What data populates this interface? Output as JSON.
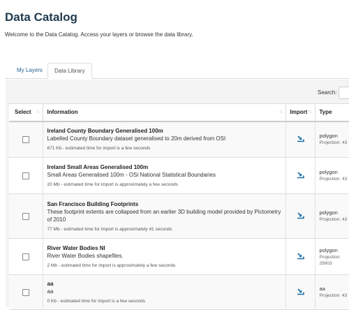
{
  "page": {
    "title": "Data Catalog",
    "welcome": "Welcome to the Data Catalog. Access your layers or browse the data library."
  },
  "tabs": [
    {
      "label": "My Layers",
      "active": false
    },
    {
      "label": "Data Library",
      "active": true
    }
  ],
  "search": {
    "label": "Search:",
    "value": ""
  },
  "table": {
    "columns": {
      "select": "Select",
      "information": "Information",
      "import": "Import",
      "type": "Type"
    },
    "rows": [
      {
        "title": "Ireland County Boundary Generalised 100m",
        "description": "Labelled County Boundary dataset generalised to 20m derived from OSI",
        "meta": "671 Kb - estimated time for import is a few seconds",
        "type": "polygon",
        "projection": "Projection: 43"
      },
      {
        "title": "Ireland Small Areas Generalised 100m",
        "description": "Small Areas Generalised 100m - OSi National Statistical Boundaries",
        "meta": "20 Mb - estimated time for import is approximately a few seconds",
        "type": "polygon",
        "projection": "Projection: 43"
      },
      {
        "title": "San Francisco Building Footprints",
        "description": "These footprint extents are collapsed from an earlier 3D building model provided by Pictometry of 2010",
        "meta": "77 Mb - estimated time for import is approximately 41 seconds",
        "type": "polygon",
        "projection": "Projection: 43"
      },
      {
        "title": "River Water Bodies NI",
        "description": "River Water Bodies shapefiles.",
        "meta": "2 Mb - estimated time for import is approximately a few seconds",
        "type": "polygon",
        "projection": "Projection:",
        "projection_extra": "29903"
      },
      {
        "title": "aa",
        "description": "aa",
        "meta": "0 Kb - estimated time for import is a few seconds",
        "type": "aa",
        "projection": "Projection: 43"
      }
    ]
  },
  "icons": {
    "import": "import-icon",
    "sort": "sort-icon"
  },
  "colors": {
    "title": "#1f3a4d",
    "link": "#2a6496",
    "import_icon": "#1e6fa8"
  }
}
